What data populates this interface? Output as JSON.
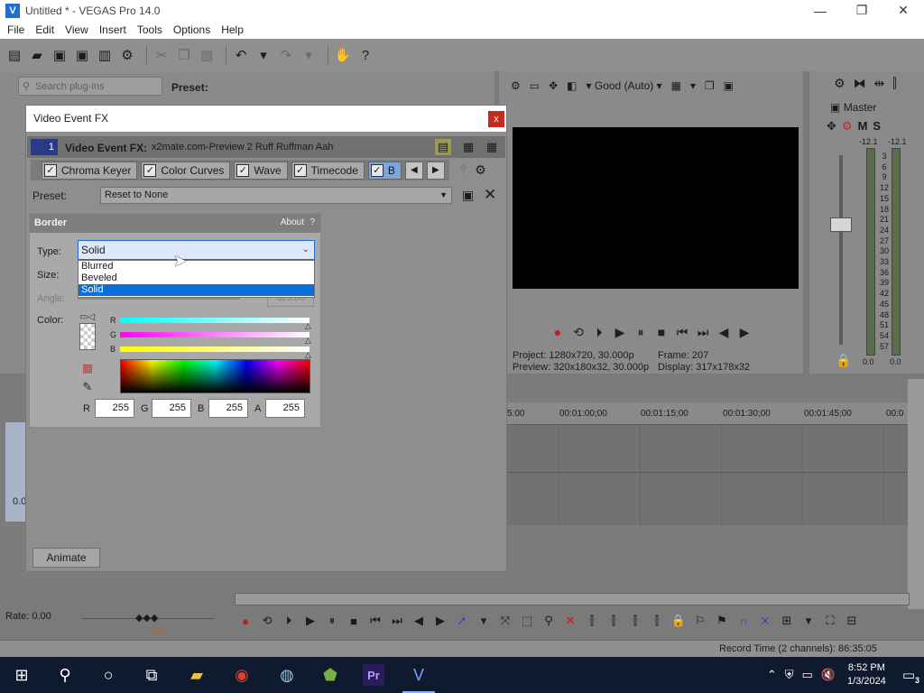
{
  "window": {
    "title": "Untitled * - VEGAS Pro 14.0",
    "app_icon": "vegas-icon",
    "minimize": "—",
    "maximize": "❐",
    "close": "✕"
  },
  "menu": [
    "File",
    "Edit",
    "View",
    "Insert",
    "Tools",
    "Options",
    "Help"
  ],
  "plugin_browser": {
    "search_placeholder": "Search plug-ins",
    "preset_label": "Preset:"
  },
  "preview": {
    "quality": "Good (Auto)",
    "project_label": "Project:",
    "project_value": "1280x720, 30.000p",
    "preview_label": "Preview:",
    "preview_value": "320x180x32, 30.000p",
    "frame_label": "Frame:",
    "frame_value": "207",
    "display_label": "Display:",
    "display_value": "317x178x32"
  },
  "master": {
    "label": "Master",
    "m": "M",
    "s": "S",
    "db_left": "-12.1",
    "db_right": "-12.1",
    "scale": [
      "3",
      "6",
      "9",
      "12",
      "15",
      "18",
      "21",
      "24",
      "27",
      "30",
      "33",
      "36",
      "39",
      "42",
      "45",
      "48",
      "51",
      "54",
      "57"
    ],
    "bottom_left": "0.0",
    "bottom_right": "0.0"
  },
  "dialog": {
    "title": "Video Event FX",
    "close": "x",
    "fx_number": "1",
    "fx_label": "Video Event FX:",
    "fx_name": "x2mate.com-Preview 2 Ruff Ruffman Aah",
    "chain": [
      "Chroma Keyer",
      "Color Curves",
      "Wave",
      "Timecode",
      "B"
    ],
    "preset_label": "Preset:",
    "preset_value": "Reset to None",
    "animate": "Animate"
  },
  "border_plugin": {
    "name": "Border",
    "about": "About",
    "help": "?",
    "type_label": "Type:",
    "type_value": "Solid",
    "type_options": [
      "Blurred",
      "Beveled",
      "Solid"
    ],
    "size_label": "Size:",
    "angle_label": "Angle:",
    "angle_value": "325.00",
    "color_label": "Color:",
    "channels": [
      "R",
      "G",
      "B"
    ],
    "r_label": "R",
    "r_value": "255",
    "g_label": "G",
    "g_value": "255",
    "b_label": "B",
    "b_value": "255",
    "a_label": "A",
    "a_value": "255"
  },
  "timeline": {
    "ruler": [
      "5:00",
      "00:01:00;00",
      "00:01:15;00",
      "00:01:30;00",
      "00:01:45;00",
      "00:0"
    ],
    "track_value": "0.0",
    "rate": "Rate: 0.00",
    "record_time": "Record Time (2 channels): 86:35:05"
  },
  "taskbar": {
    "time": "8:52 PM",
    "date": "1/3/2024",
    "notifications": "3"
  },
  "colors": {
    "accent": "#0a6fd8",
    "close_red": "#c42b1c",
    "record_red": "#c81818"
  }
}
